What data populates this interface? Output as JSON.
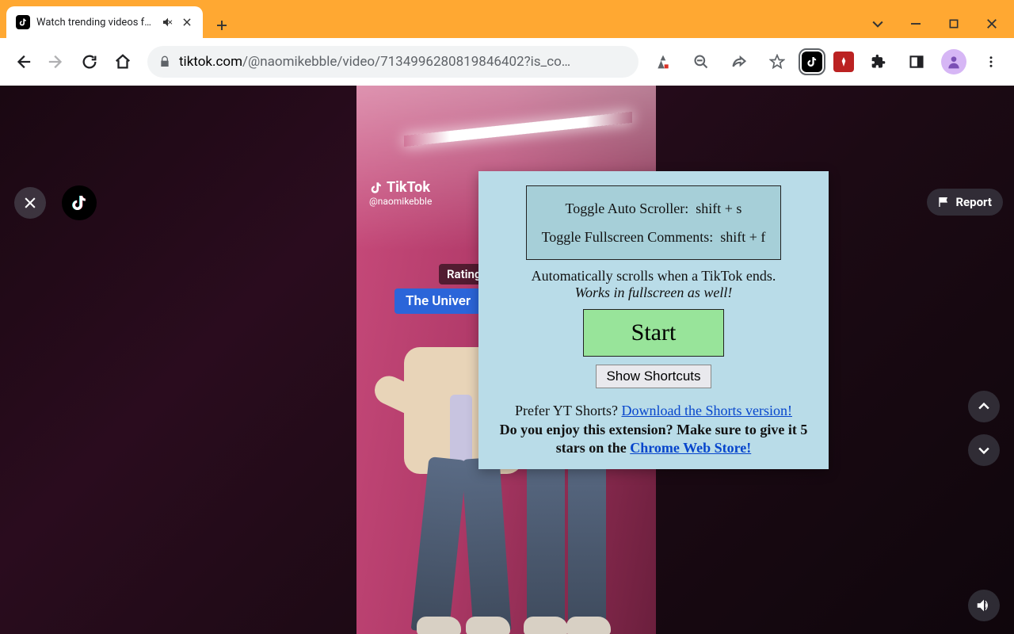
{
  "browser": {
    "tab_title": "Watch trending videos for yo",
    "url_domain": "tiktok.com",
    "url_path": "/@naomikebble/video/7134996280819846402?is_co…"
  },
  "tiktok": {
    "brand": "TikTok",
    "handle": "@naomikebble",
    "badge_rating": "Rating",
    "badge_uni": "The Univer",
    "report": "Report"
  },
  "popup": {
    "shortcut1_label": "Toggle Auto Scroller:",
    "shortcut1_key": "shift + s",
    "shortcut2_label": "Toggle Fullscreen Comments:",
    "shortcut2_key": "shift + f",
    "desc": "Automatically scrolls when a TikTok ends.",
    "note": "Works in fullscreen as well!",
    "start": "Start",
    "show_shortcuts": "Show Shortcuts",
    "prefer_q": "Prefer YT Shorts? ",
    "prefer_link": "Download the Shorts version!",
    "rate_1": "Do you enjoy this extension? Make sure to give it 5 stars on the ",
    "rate_link": "Chrome Web Store!"
  }
}
